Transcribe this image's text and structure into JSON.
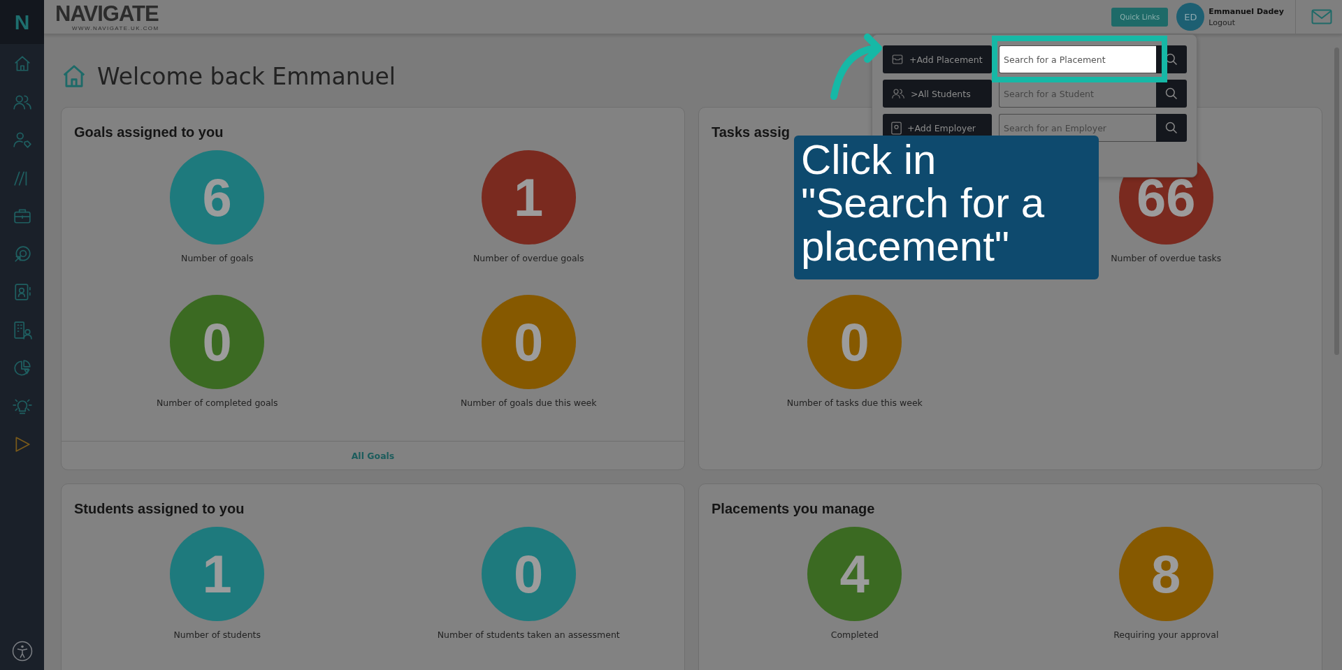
{
  "sidebar": {
    "logo": "N",
    "items": [
      {
        "kind": "home"
      },
      {
        "kind": "users"
      },
      {
        "kind": "user-tag"
      },
      {
        "kind": "lines"
      },
      {
        "kind": "briefcase"
      },
      {
        "kind": "target"
      },
      {
        "kind": "contact"
      },
      {
        "kind": "building"
      },
      {
        "kind": "pie"
      },
      {
        "kind": "bulb"
      },
      {
        "kind": "play"
      }
    ]
  },
  "header": {
    "logo": "NAVIGATE",
    "logo_url": "WWW.NAVIGATE.UK.COM",
    "quick_links": "Quick Links",
    "user": {
      "initials": "ED",
      "name": "Emmanuel Dadey",
      "logout": "Logout"
    }
  },
  "page_title": "Welcome back Emmanuel",
  "cards": [
    {
      "title": "Goals assigned to you",
      "tiles": [
        {
          "value": "6",
          "label": "Number of goals",
          "color": "#1e7a7d"
        },
        {
          "value": "1",
          "label": "Number of overdue goals",
          "color": "#7a2a1f"
        },
        {
          "value": "0",
          "label": "Number of completed goals",
          "color": "#3b6a22"
        },
        {
          "value": "0",
          "label": "Number of goals due this week",
          "color": "#865900"
        }
      ],
      "footer": "All Goals"
    },
    {
      "title": "Tasks assig",
      "tiles": [
        {
          "value": "66",
          "label": "Number of overdue tasks",
          "color": "#7a2a1f"
        },
        {
          "value": "0",
          "label": "Number of tasks due this week",
          "color": "#865900"
        }
      ]
    },
    {
      "title": "Students assigned to you",
      "tiles": [
        {
          "value": "1",
          "label": "Number of students",
          "color": "#1e7a7d"
        },
        {
          "value": "0",
          "label": "Number of students taken an assessment",
          "color": "#1e7a7d"
        }
      ]
    },
    {
      "title": "Placements you manage",
      "tiles": [
        {
          "value": "4",
          "label": "Completed",
          "color": "#3b6a22"
        },
        {
          "value": "8",
          "label": "Requiring your approval",
          "color": "#865900"
        }
      ]
    }
  ],
  "quick_links_panel": [
    {
      "kind": "placement",
      "button": "+Add Placement",
      "placeholder": "Search for a Placement",
      "highlighted": true
    },
    {
      "kind": "students",
      "button": ">All Students",
      "placeholder": "Search for a Student",
      "highlighted": false
    },
    {
      "kind": "employer",
      "button": "+Add Employer",
      "placeholder": "Search for an Employer",
      "highlighted": false
    }
  ],
  "tooltip": "Click in \"Search for a placement\""
}
